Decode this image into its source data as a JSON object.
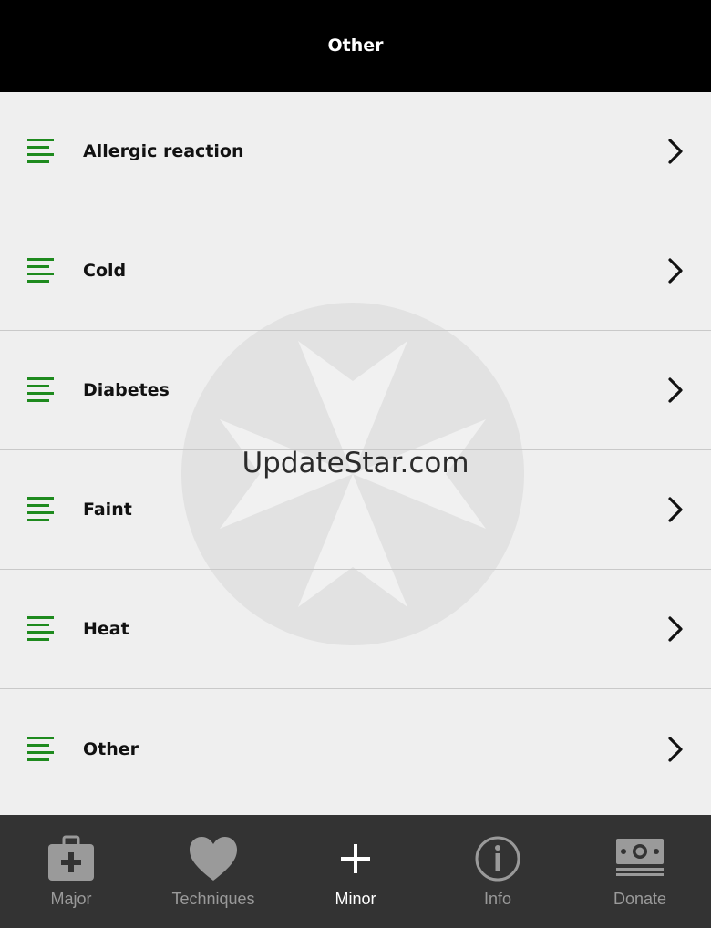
{
  "header": {
    "title": "Other"
  },
  "watermark": {
    "text": "UpdateStar.com"
  },
  "list": {
    "items": [
      {
        "label": "Allergic reaction"
      },
      {
        "label": "Cold"
      },
      {
        "label": "Diabetes"
      },
      {
        "label": "Faint"
      },
      {
        "label": "Heat"
      },
      {
        "label": "Other"
      }
    ],
    "icon": "list-lines-icon",
    "chevron": "chevron-right-icon"
  },
  "tabs": [
    {
      "label": "Major",
      "icon": "first-aid-kit-icon",
      "active": false
    },
    {
      "label": "Techniques",
      "icon": "heart-icon",
      "active": false
    },
    {
      "label": "Minor",
      "icon": "plus-icon",
      "active": true
    },
    {
      "label": "Info",
      "icon": "info-icon",
      "active": false
    },
    {
      "label": "Donate",
      "icon": "cash-icon",
      "active": false
    }
  ],
  "colors": {
    "header_bg": "#000000",
    "list_bg": "#efefef",
    "accent_green": "#1e8a1e",
    "tabbar_bg": "#333333",
    "tab_inactive": "#9a9a9a",
    "tab_active": "#ffffff"
  }
}
